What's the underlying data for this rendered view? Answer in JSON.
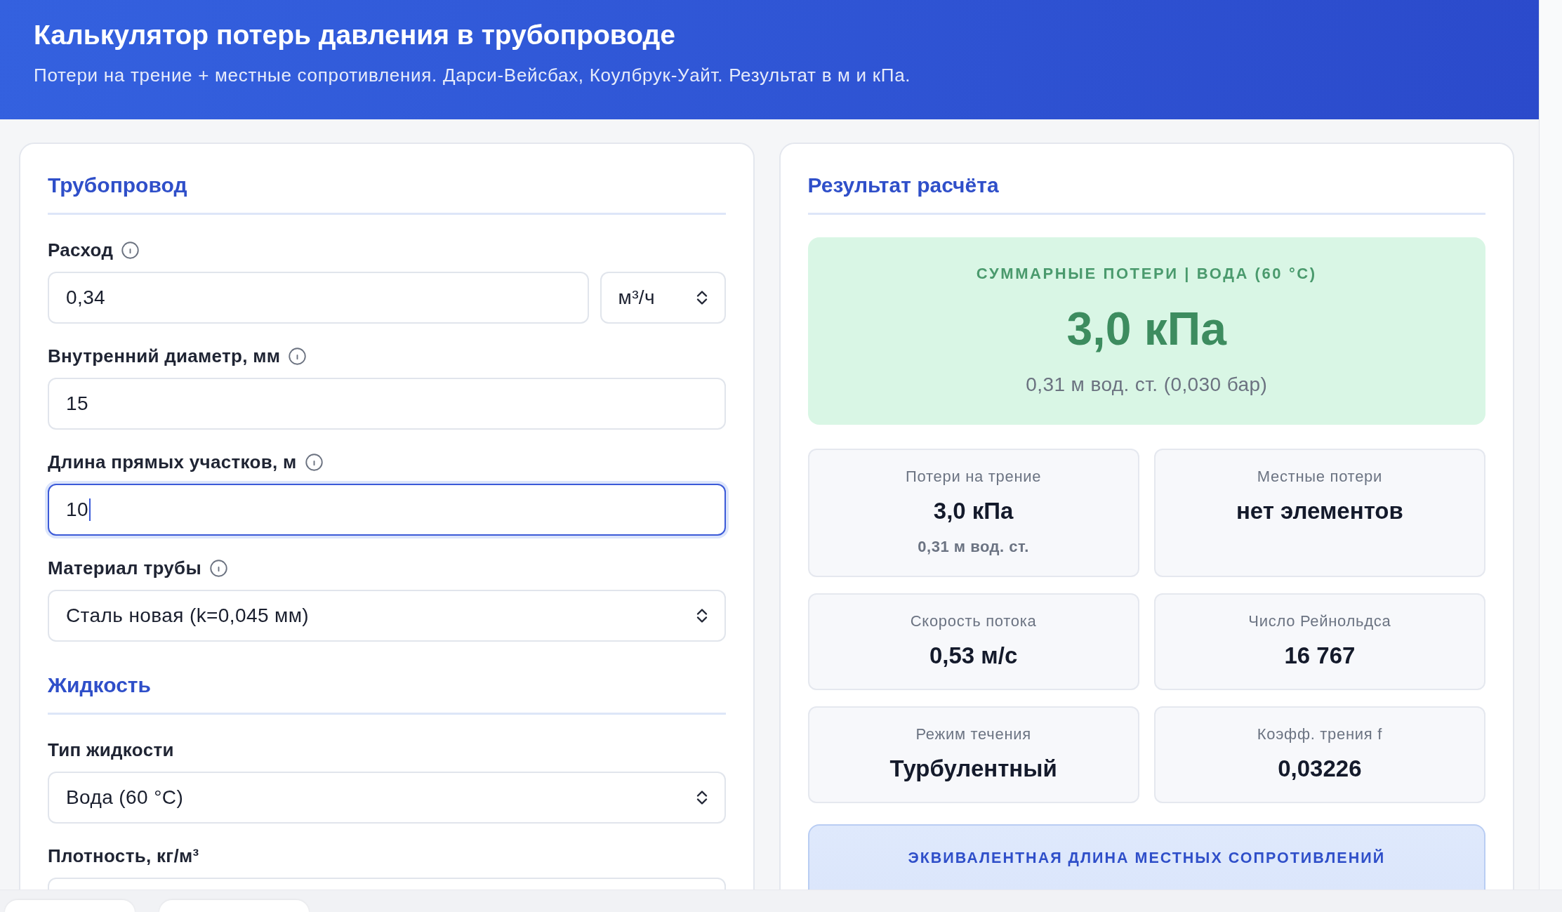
{
  "header": {
    "title": "Калькулятор потерь давления в трубопроводе",
    "subtitle": "Потери на трение + местные сопротивления. Дарси-Вейсбах, Коулбрук-Уайт. Результат в м и кПа."
  },
  "form": {
    "sections": [
      {
        "title": "Трубопровод",
        "fields": [
          {
            "kind": "input_unit",
            "label": "Расход",
            "info": true,
            "value": "0,34",
            "unit": "м³/ч",
            "focused": false
          },
          {
            "kind": "input",
            "label": "Внутренний диаметр, мм",
            "info": true,
            "value": "15",
            "focused": false
          },
          {
            "kind": "input",
            "label": "Длина прямых участков, м",
            "info": true,
            "value": "10",
            "focused": true
          },
          {
            "kind": "select",
            "label": "Материал трубы",
            "info": true,
            "value": "Сталь новая (k=0,045 мм)",
            "focused": false
          }
        ]
      },
      {
        "title": "Жидкость",
        "fields": [
          {
            "kind": "select",
            "label": "Тип жидкости",
            "info": false,
            "value": "Вода (60 °C)",
            "focused": false
          },
          {
            "kind": "input",
            "label": "Плотность, кг/м³",
            "info": false,
            "focused": false
          }
        ]
      }
    ]
  },
  "results": {
    "title": "Результат расчёта",
    "summary": {
      "caption": "СУММАРНЫЕ ПОТЕРИ | ВОДА (60 °C)",
      "value": "3,0 кПа",
      "detail": "0,31 м вод. ст. (0,030 бар)"
    },
    "metrics": [
      {
        "label": "Потери на трение",
        "value": "3,0 кПа",
        "note": "0,31 м вод. ст."
      },
      {
        "label": "Местные потери",
        "value": "нет элементов"
      },
      {
        "label": "Скорость потока",
        "value": "0,53 м/с"
      },
      {
        "label": "Число Рейнольдса",
        "value": "16 767"
      },
      {
        "label": "Режим течения",
        "value": "Турбулентный"
      },
      {
        "label": "Коэфф. трения f",
        "value": "0,03226"
      }
    ],
    "equivalent_length": {
      "caption": "ЭКВИВАЛЕНТНАЯ ДЛИНА МЕСТНЫХ СОПРОТИВЛЕНИЙ"
    }
  }
}
